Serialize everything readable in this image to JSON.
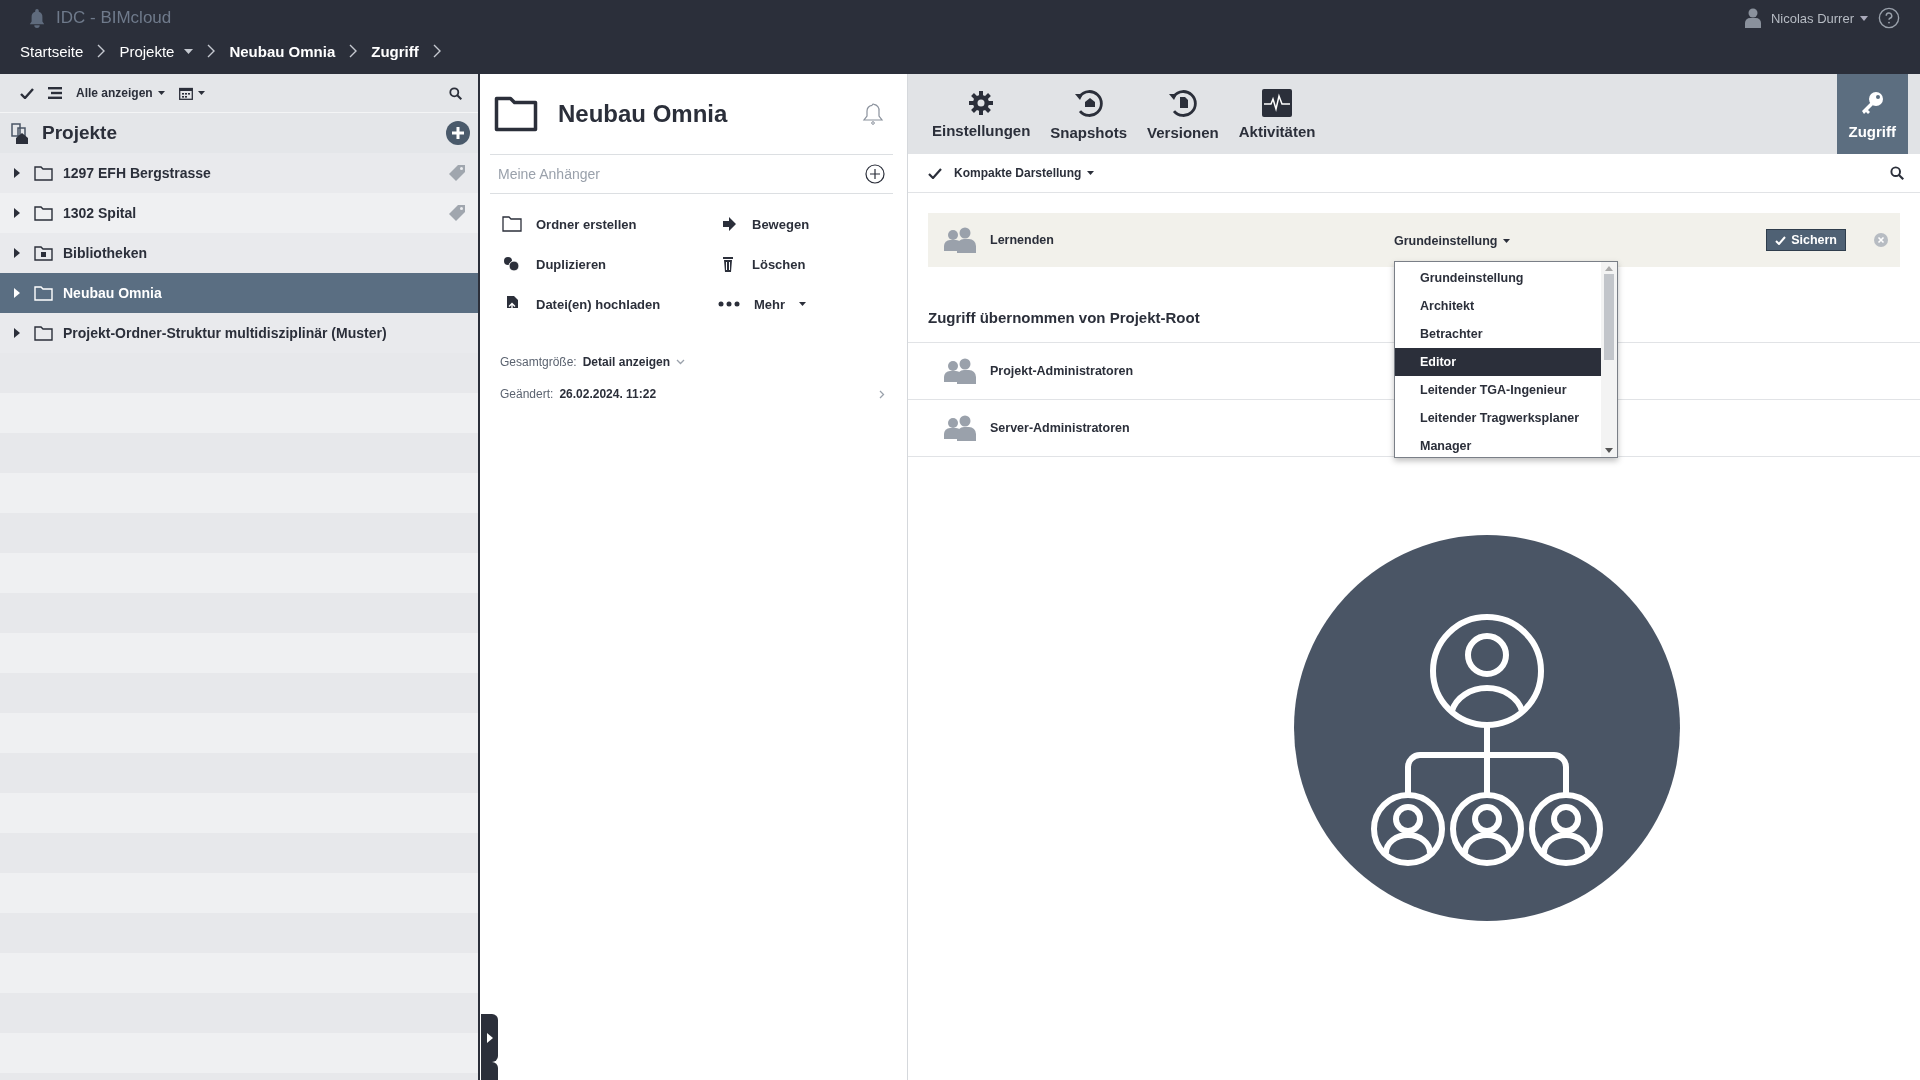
{
  "topbar": {
    "app_title": "IDC - BIMcloud",
    "user_name": "Nicolas Durrer",
    "breadcrumbs": [
      {
        "label": "Startseite",
        "kind": "link",
        "dropdown": false
      },
      {
        "label": "Projekte",
        "kind": "link",
        "dropdown": true
      },
      {
        "label": "Neubau Omnia",
        "kind": "current",
        "dropdown": false
      },
      {
        "label": "Zugriff",
        "kind": "current",
        "dropdown": false
      }
    ]
  },
  "left_panel": {
    "filter": "Alle anzeigen",
    "title": "Projekte",
    "items": [
      {
        "label": "1297 EFH Bergstrasse",
        "kind": "folder",
        "tagged": true,
        "selected": false
      },
      {
        "label": "1302 Spital",
        "kind": "folder",
        "tagged": true,
        "selected": false
      },
      {
        "label": "Bibliotheken",
        "kind": "library",
        "tagged": false,
        "selected": false
      },
      {
        "label": "Neubau Omnia",
        "kind": "folder",
        "tagged": false,
        "selected": true
      },
      {
        "label": "Projekt-Ordner-Struktur multidisziplinär (Muster)",
        "kind": "folder",
        "tagged": false,
        "selected": false
      }
    ]
  },
  "detail_panel": {
    "title": "Neubau Omnia",
    "followers_placeholder": "Meine Anhänger",
    "actions": [
      {
        "label": "Ordner erstellen",
        "kind": "folder"
      },
      {
        "label": "Bewegen",
        "kind": "move"
      },
      {
        "label": "Duplizieren",
        "kind": "duplicate"
      },
      {
        "label": "Löschen",
        "kind": "delete"
      },
      {
        "label": "Datei(en) hochladen",
        "kind": "upload"
      },
      {
        "label": "Mehr",
        "kind": "more"
      }
    ],
    "size_label": "Gesamtgröße:",
    "size_value": "Detail anzeigen",
    "changed_label": "Geändert:",
    "changed_value": "26.02.2024. 11:22"
  },
  "access_panel": {
    "tabs": [
      {
        "label": "Einstellungen",
        "kind": "gear",
        "selected": false
      },
      {
        "label": "Snapshots",
        "kind": "snapshot",
        "selected": false
      },
      {
        "label": "Versionen",
        "kind": "version",
        "selected": false
      },
      {
        "label": "Aktivitäten",
        "kind": "activity",
        "selected": false
      },
      {
        "label": "Zugriff",
        "kind": "key",
        "selected": true
      }
    ],
    "compact_view": {
      "label": "Kompakte Darstellung",
      "checked": true
    },
    "edit_row": {
      "group": "Lernenden",
      "role": "Grundeinstellung",
      "save": "Sichern"
    },
    "role_options": [
      {
        "label": "Grundeinstellung",
        "selected": false
      },
      {
        "label": "Architekt",
        "selected": false
      },
      {
        "label": "Betrachter",
        "selected": false
      },
      {
        "label": "Editor",
        "selected": true
      },
      {
        "label": "Leitender TGA-Ingenieur",
        "selected": false
      },
      {
        "label": "Leitender Tragwerksplaner",
        "selected": false
      },
      {
        "label": "Manager",
        "selected": false
      }
    ],
    "inherited_heading": "Zugriff übernommen von Projekt-Root",
    "inherited_groups": [
      "Projekt-Administratoren",
      "Server-Administratoren"
    ]
  }
}
